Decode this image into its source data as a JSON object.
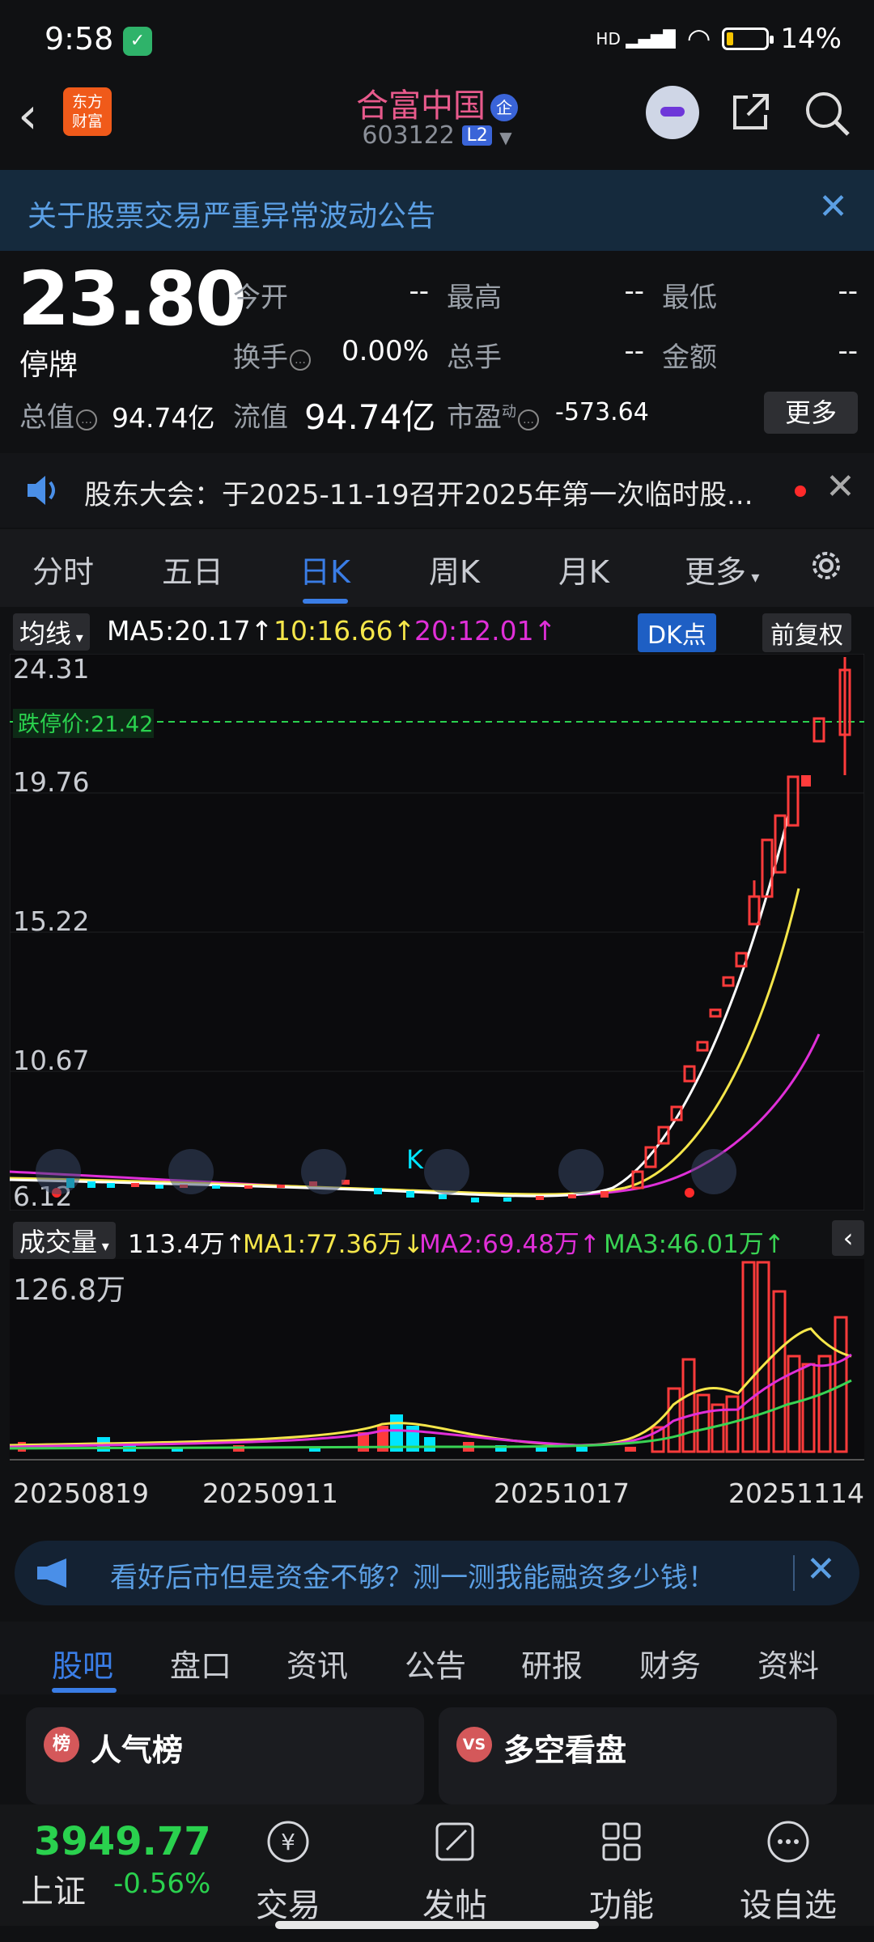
{
  "status_bar": {
    "time": "9:58",
    "battery": "14%",
    "network": "HD"
  },
  "header": {
    "logo_text": "东方\n财富",
    "stock_name": "合富中国",
    "qi_badge": "企",
    "stock_code": "603122",
    "level_badge": "L2"
  },
  "notice": {
    "text": "关于股票交易严重异常波动公告",
    "close": "✕"
  },
  "quote": {
    "price": "23.80",
    "state": "停牌",
    "open_label": "今开",
    "open_value": "--",
    "high_label": "最高",
    "high_value": "--",
    "low_label": "最低",
    "low_value": "--",
    "turnover_label": "换手",
    "turnover_value": "0.00%",
    "volume_label": "总手",
    "volume_value": "--",
    "amount_label": "金额",
    "amount_value": "--",
    "mktcap_label": "总值",
    "mktcap_value": "94.74亿",
    "float_label": "流值",
    "float_value": "94.74亿",
    "pe_label": "市盈",
    "pe_sup": "动",
    "pe_value": "-573.64",
    "more": "更多"
  },
  "shareholder_notice": {
    "text": "股东大会：于2025-11-19召开2025年第一次临时股..."
  },
  "tabs": [
    "分时",
    "五日",
    "日K",
    "周K",
    "月K",
    "更多"
  ],
  "chart_controls": {
    "ma_dropdown": "均线",
    "ma5": "MA5:20.17",
    "ma10": "10:16.66",
    "ma20": "20:12.01",
    "dk_button": "DK点",
    "adjust_button": "前复权",
    "limit_down_label": "跌停价:21.42",
    "y_ticks": [
      "24.31",
      "19.76",
      "15.22",
      "10.67",
      "6.12"
    ],
    "colors": {
      "up": "#ff3b3b",
      "down": "#00e5ff",
      "ma5": "#ffffff",
      "ma10": "#f5e64a",
      "ma20": "#e02fd8",
      "ma3": "#39d353",
      "limit": "#2ad14e"
    }
  },
  "volume_controls": {
    "dropdown": "成交量",
    "vol": "113.4万",
    "ma1": "MA1:77.36万",
    "ma2": "MA2:69.48万",
    "ma3": "MA3:46.01万",
    "y_max": "126.8万"
  },
  "dates": [
    "20250819",
    "20250911",
    "20251017",
    "20251114"
  ],
  "chart_data": {
    "type": "candlestick",
    "series": [
      {
        "name": "MA5",
        "value": 20.17
      },
      {
        "name": "10",
        "value": 16.66
      },
      {
        "name": "20",
        "value": 12.01
      }
    ],
    "ylim": [
      6.12,
      24.31
    ],
    "limit_down": 21.42,
    "volume_max": "126.8万",
    "x_labels": [
      "20250819",
      "20250911",
      "20251017",
      "20251114"
    ]
  },
  "ad": {
    "text": "看好后市但是资金不够？测一测我能融资多少钱！"
  },
  "sub_tabs": [
    "股吧",
    "盘口",
    "资讯",
    "公告",
    "研报",
    "财务",
    "资料"
  ],
  "cards": [
    {
      "title": "人气榜",
      "icon": "榜"
    },
    {
      "title": "多空看盘",
      "icon": "VS"
    }
  ],
  "bottom_nav": {
    "index_value": "3949.77",
    "index_name": "上证",
    "index_change": "-0.56%",
    "items": [
      "交易",
      "发帖",
      "功能",
      "设自选"
    ]
  }
}
